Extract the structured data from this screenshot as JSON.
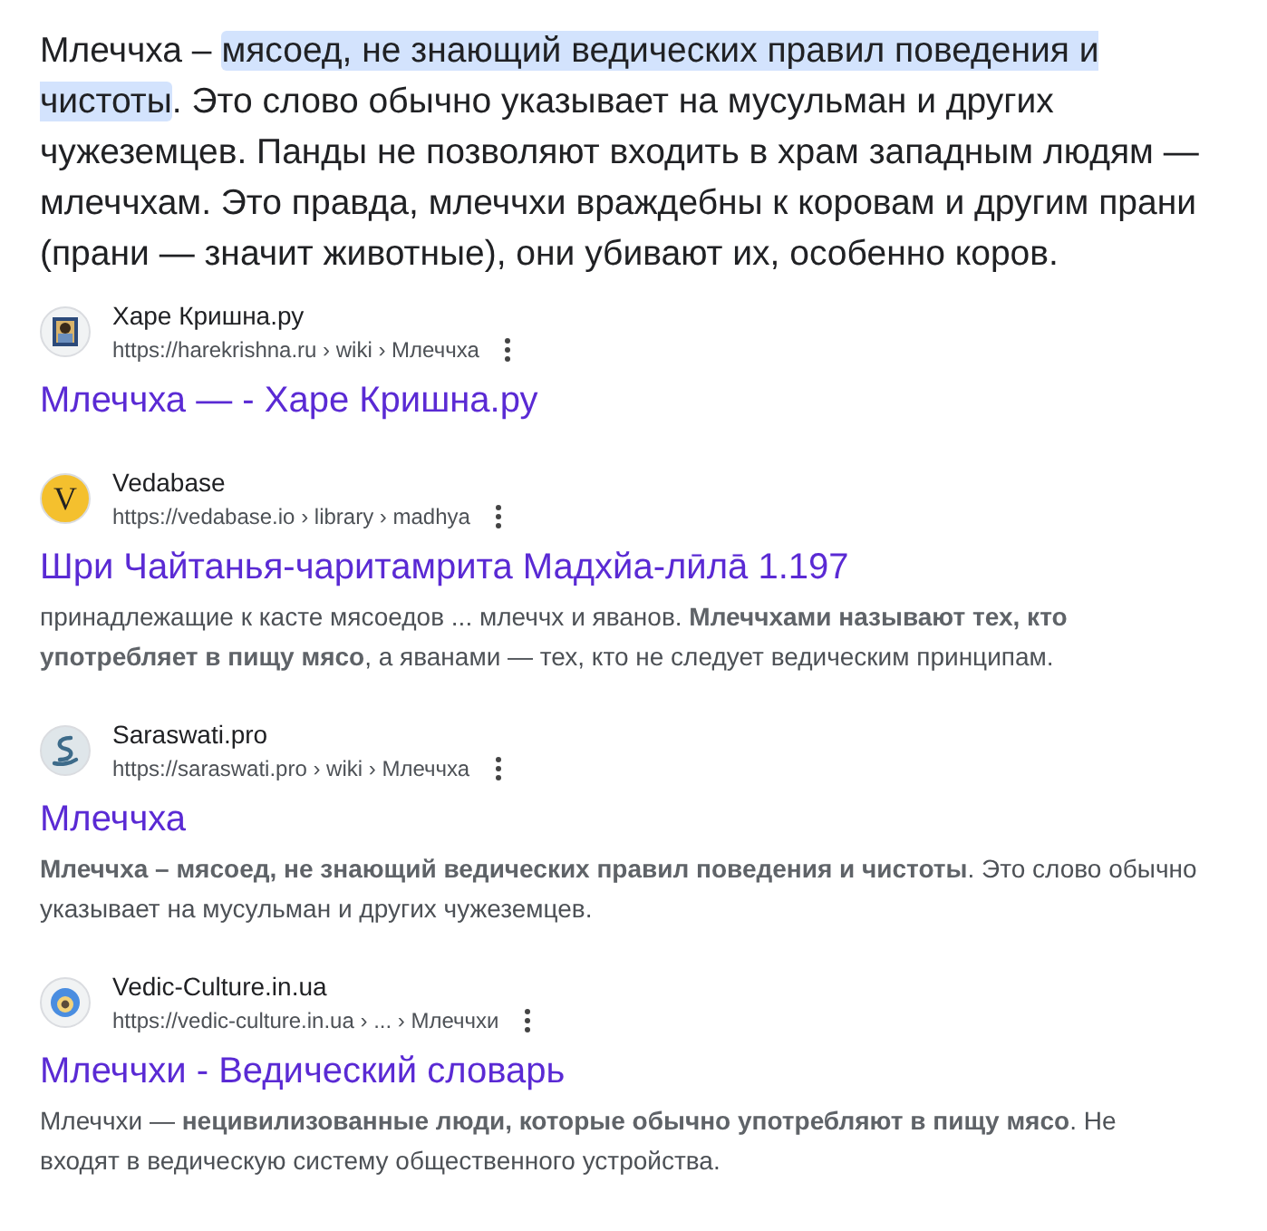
{
  "featured_snippet": {
    "parts": [
      {
        "text": "Млеччха – ",
        "highlighted": false
      },
      {
        "text": "мясоед, не знающий ведических правил поведения и чистоты",
        "highlighted": true
      },
      {
        "text": ". Это слово обычно указывает на мусульман и других чужеземцев. Панды не позволяют входить в храм западным людям — млеччхам. Это правда, млеччхи враждебны к коровам и другим прани (прани — значит животные), они убивают их, особенно коров.",
        "highlighted": false
      }
    ]
  },
  "results": [
    {
      "site": "Харе Кришна.ру",
      "url": "https://harekrishna.ru › wiki › Млеччха",
      "title": "Млеччха — - Харе Кришна.ру"
    },
    {
      "site": "Vedabase",
      "url": "https://vedabase.io › library › madhya",
      "favicon": {
        "kind": "letter",
        "letter": "V"
      },
      "title": "Шри Чайтанья-чаритамрита Мадхйа-лӣлā 1.197",
      "snippet": "принадлежащие к касте мясоедов ... млеччх и яванов. **Млеччхами называют тех, кто употребляет в пищу мясо**, а яванами — тех, кто не следует ведическим принципам."
    },
    {
      "site": "Saraswati.pro",
      "url": "https://saraswati.pro › wiki › Млеччха",
      "favicon": {
        "kind": "swirl"
      },
      "title": "Млеччха",
      "snippet": "**Млеччха – мясоед, не знающий ведических правил поведения и чистоты**. Это слово обычно указывает на мусульман и других чужеземцев."
    },
    {
      "site": "Vedic-Culture.in.ua",
      "url": "https://vedic-culture.in.ua › ... › Млеччхи",
      "favicon": {
        "kind": "badge"
      },
      "title": "Млеччхи - Ведический словарь",
      "snippet": "Млеччхи — **нецивилизованные люди, которые обычно употребляют в пищу мясо**. Не входят в ведическую систему общественного устройства."
    }
  ]
}
